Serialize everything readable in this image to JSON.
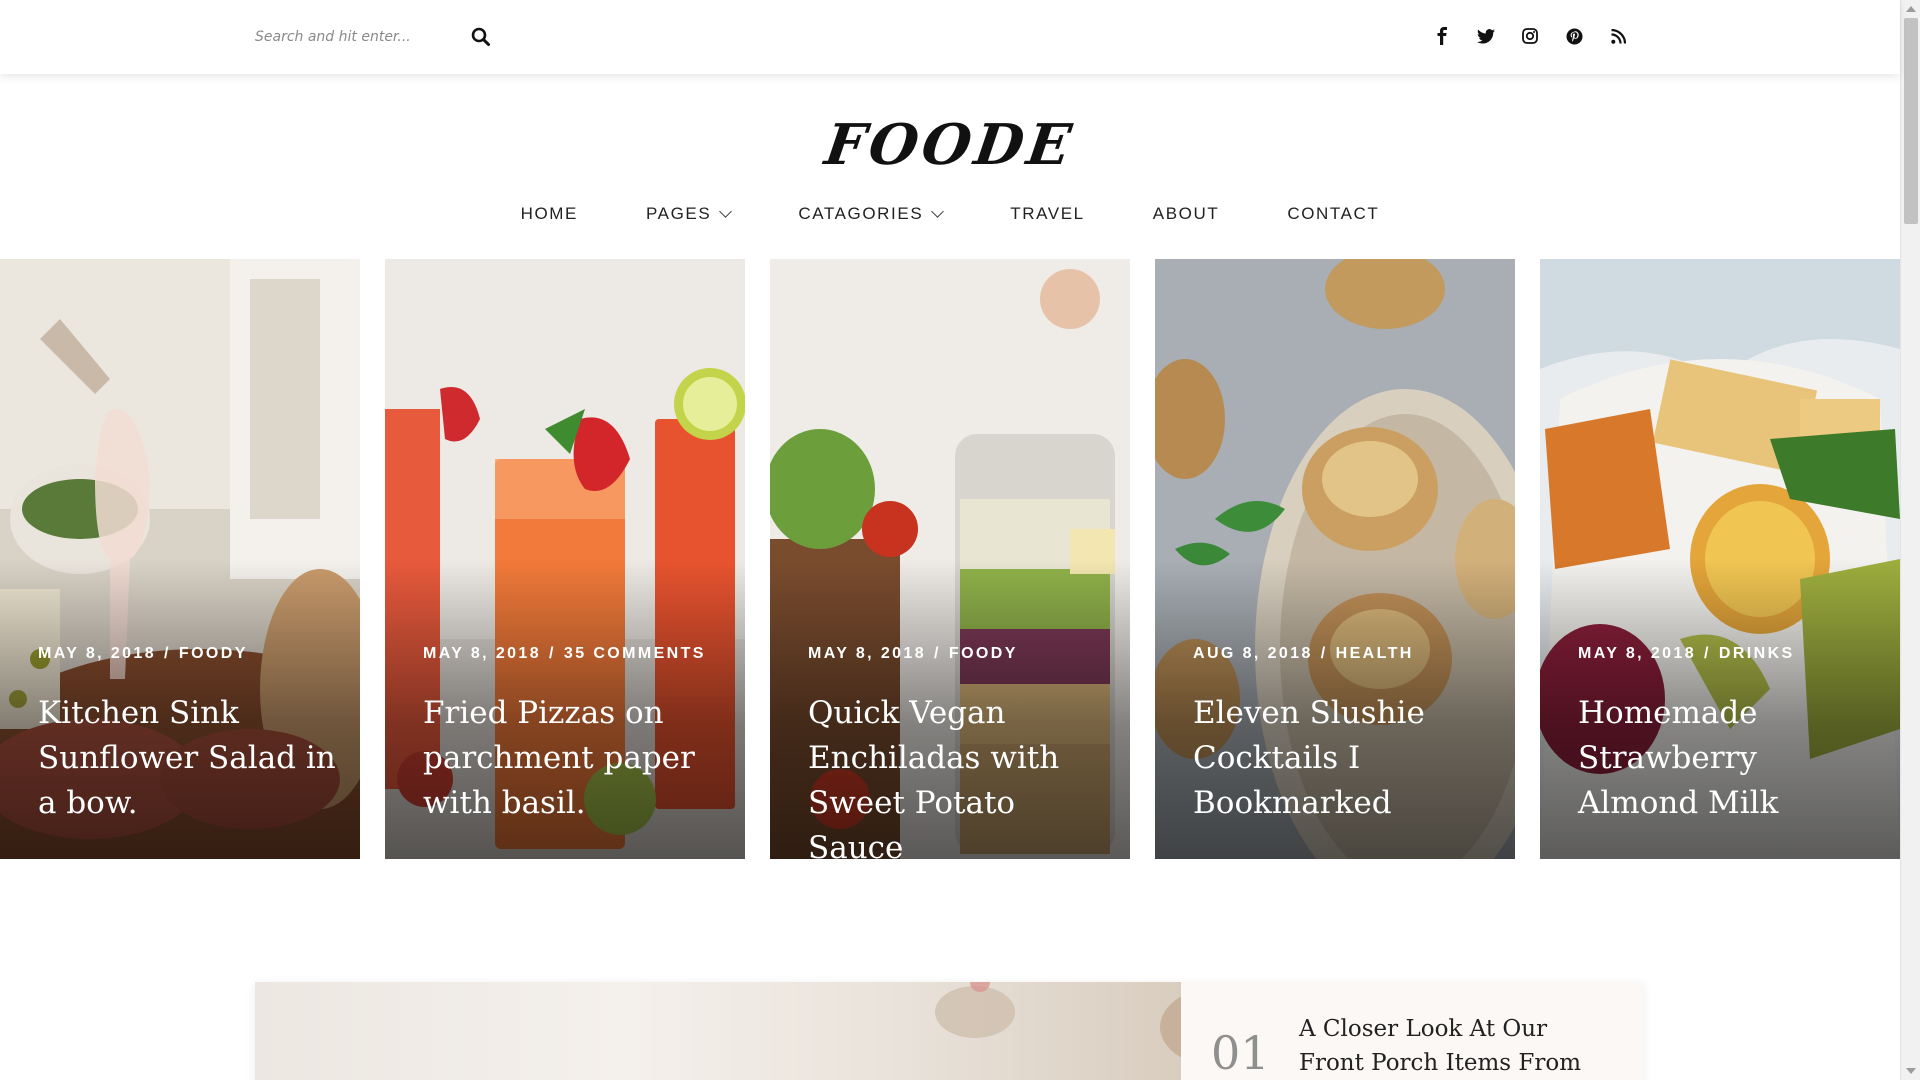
{
  "search": {
    "placeholder": "Search and hit enter..."
  },
  "icons": {
    "search": "search-icon",
    "social": [
      "facebook-icon",
      "twitter-icon",
      "instagram-icon",
      "pinterest-icon",
      "rss-icon"
    ]
  },
  "logo": {
    "text": "FOODE"
  },
  "nav": {
    "items": [
      {
        "label": "HOME",
        "dropdown": false
      },
      {
        "label": "PAGES",
        "dropdown": true
      },
      {
        "label": "CATAGORIES",
        "dropdown": true
      },
      {
        "label": "TRAVEL",
        "dropdown": false
      },
      {
        "label": "ABOUT",
        "dropdown": false
      },
      {
        "label": "CONTACT",
        "dropdown": false
      }
    ]
  },
  "cards": [
    {
      "date": "MAY 8, 2018",
      "tag": "FOODY",
      "title": "Kitchen Sink Sunflower Salad in a bow."
    },
    {
      "date": "MAY 8, 2018",
      "tag": "35 COMMENTS",
      "title": "Fried Pizzas on parchment paper with basil."
    },
    {
      "date": "MAY 8, 2018",
      "tag": "FOODY",
      "title": "Quick Vegan Enchiladas with Sweet Potato Sauce"
    },
    {
      "date": "AUG 8, 2018",
      "tag": "HEALTH",
      "title": "Eleven Slushie Cocktails I Bookmarked"
    },
    {
      "date": "MAY 8, 2018",
      "tag": "DRINKS",
      "title": "Homemade Strawberry Almond Milk"
    }
  ],
  "meta_separator": "/",
  "featured": {
    "number": "01",
    "title": "A Closer Look At Our Front Porch Items From Lowe’s"
  },
  "colors": {
    "text": "#111111",
    "nav": "#222222",
    "overlay_text": "#ffffff",
    "feature_bg": "#fbf8f5"
  }
}
